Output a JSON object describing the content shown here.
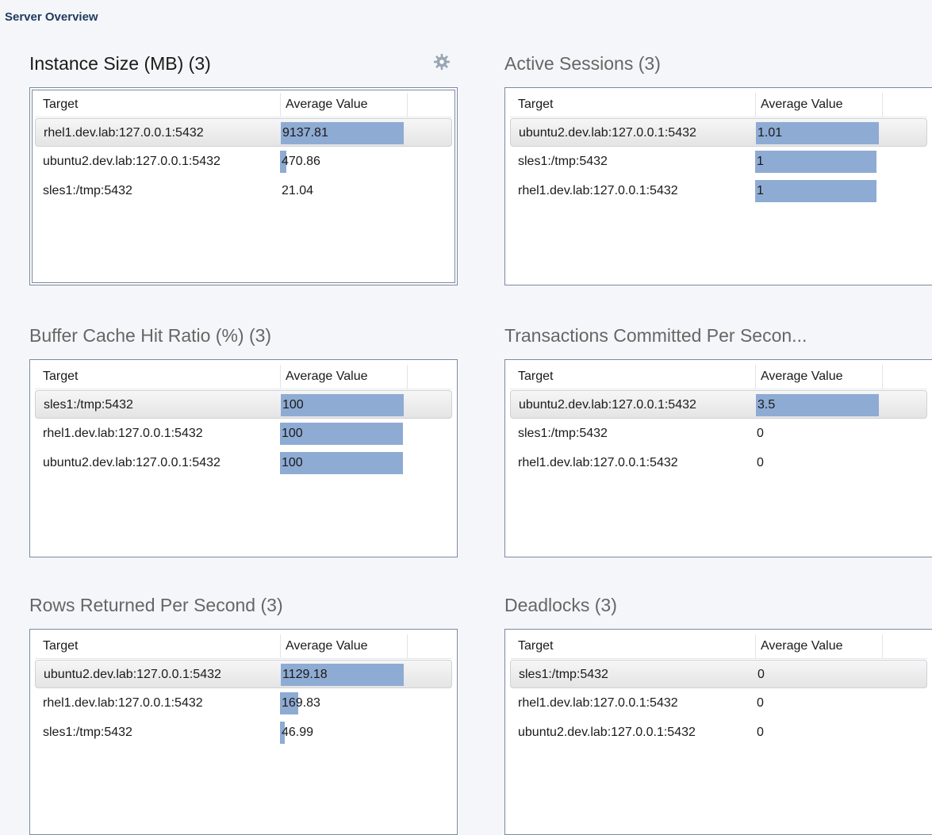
{
  "page": {
    "title": "Server Overview"
  },
  "headers": {
    "target": "Target",
    "value": "Average Value"
  },
  "panels": [
    {
      "title": "Instance Size (MB) (3)",
      "rows": [
        {
          "target": "rhel1.dev.lab:127.0.0.1:5432",
          "value": "9137.81",
          "bar_fraction": 1.0
        },
        {
          "target": "ubuntu2.dev.lab:127.0.0.1:5432",
          "value": "470.86",
          "bar_fraction": 0.052
        },
        {
          "target": "sles1:/tmp:5432",
          "value": "21.04",
          "bar_fraction": 0.0
        }
      ]
    },
    {
      "title": "Active Sessions (3)",
      "rows": [
        {
          "target": "ubuntu2.dev.lab:127.0.0.1:5432",
          "value": "1.01",
          "bar_fraction": 1.0
        },
        {
          "target": "sles1:/tmp:5432",
          "value": "1",
          "bar_fraction": 0.99
        },
        {
          "target": "rhel1.dev.lab:127.0.0.1:5432",
          "value": "1",
          "bar_fraction": 0.99
        }
      ]
    },
    {
      "title": "Buffer Cache Hit Ratio (%) (3)",
      "rows": [
        {
          "target": "sles1:/tmp:5432",
          "value": "100",
          "bar_fraction": 1.0
        },
        {
          "target": "rhel1.dev.lab:127.0.0.1:5432",
          "value": "100",
          "bar_fraction": 1.0
        },
        {
          "target": "ubuntu2.dev.lab:127.0.0.1:5432",
          "value": "100",
          "bar_fraction": 1.0
        }
      ]
    },
    {
      "title": "Transactions Committed Per Secon...",
      "rows": [
        {
          "target": "ubuntu2.dev.lab:127.0.0.1:5432",
          "value": "3.5",
          "bar_fraction": 1.0
        },
        {
          "target": "sles1:/tmp:5432",
          "value": "0",
          "bar_fraction": 0.0
        },
        {
          "target": "rhel1.dev.lab:127.0.0.1:5432",
          "value": "0",
          "bar_fraction": 0.0
        }
      ]
    },
    {
      "title": "Rows Returned Per Second (3)",
      "rows": [
        {
          "target": "ubuntu2.dev.lab:127.0.0.1:5432",
          "value": "1129.18",
          "bar_fraction": 1.0
        },
        {
          "target": "rhel1.dev.lab:127.0.0.1:5432",
          "value": "169.83",
          "bar_fraction": 0.15
        },
        {
          "target": "sles1:/tmp:5432",
          "value": "46.99",
          "bar_fraction": 0.04
        }
      ]
    },
    {
      "title": "Deadlocks (3)",
      "rows": [
        {
          "target": "sles1:/tmp:5432",
          "value": "0",
          "bar_fraction": 0.0
        },
        {
          "target": "rhel1.dev.lab:127.0.0.1:5432",
          "value": "0",
          "bar_fraction": 0.0
        },
        {
          "target": "ubuntu2.dev.lab:127.0.0.1:5432",
          "value": "0",
          "bar_fraction": 0.0
        }
      ]
    }
  ],
  "colors": {
    "bar": "#8eabd3",
    "title_active": "#1a1a1a",
    "title_inactive": "#666666"
  },
  "icons": {
    "settings": "gear-icon"
  }
}
